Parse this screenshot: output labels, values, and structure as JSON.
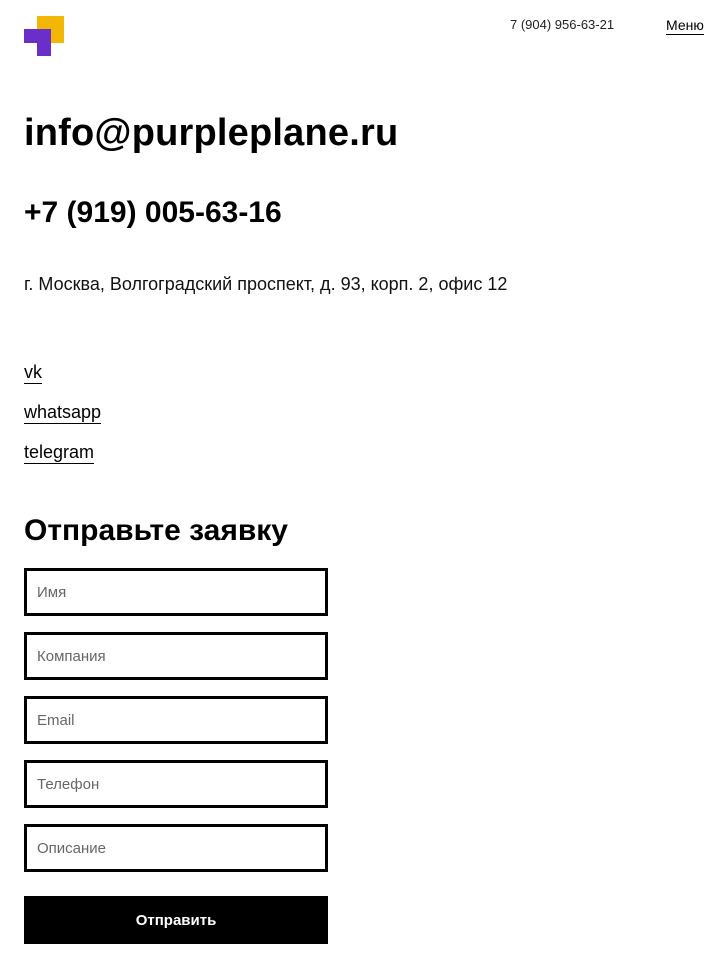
{
  "header": {
    "logo_icon": "purpleplane-logo-icon",
    "phone": "7 (904) 956-63-21",
    "menu_label": "Меню"
  },
  "contacts": {
    "email": "info@purpleplane.ru",
    "phone": "+7 (919) 005-63-16",
    "address": "г. Москва, Волгоградский проспект, д. 93, корп. 2, офис 12"
  },
  "social": {
    "vk": "vk",
    "whatsapp": "whatsapp",
    "telegram": "telegram"
  },
  "form": {
    "title": "Отправьте заявку",
    "fields": {
      "name_placeholder": "Имя",
      "company_placeholder": "Компания",
      "email_placeholder": "Email",
      "phone_placeholder": "Телефон",
      "description_placeholder": "Описание"
    },
    "submit_label": "Отправить"
  },
  "colors": {
    "logo_yellow": "#f2b705",
    "logo_purple": "#6a2fc8",
    "text": "#000000",
    "background": "#ffffff"
  }
}
